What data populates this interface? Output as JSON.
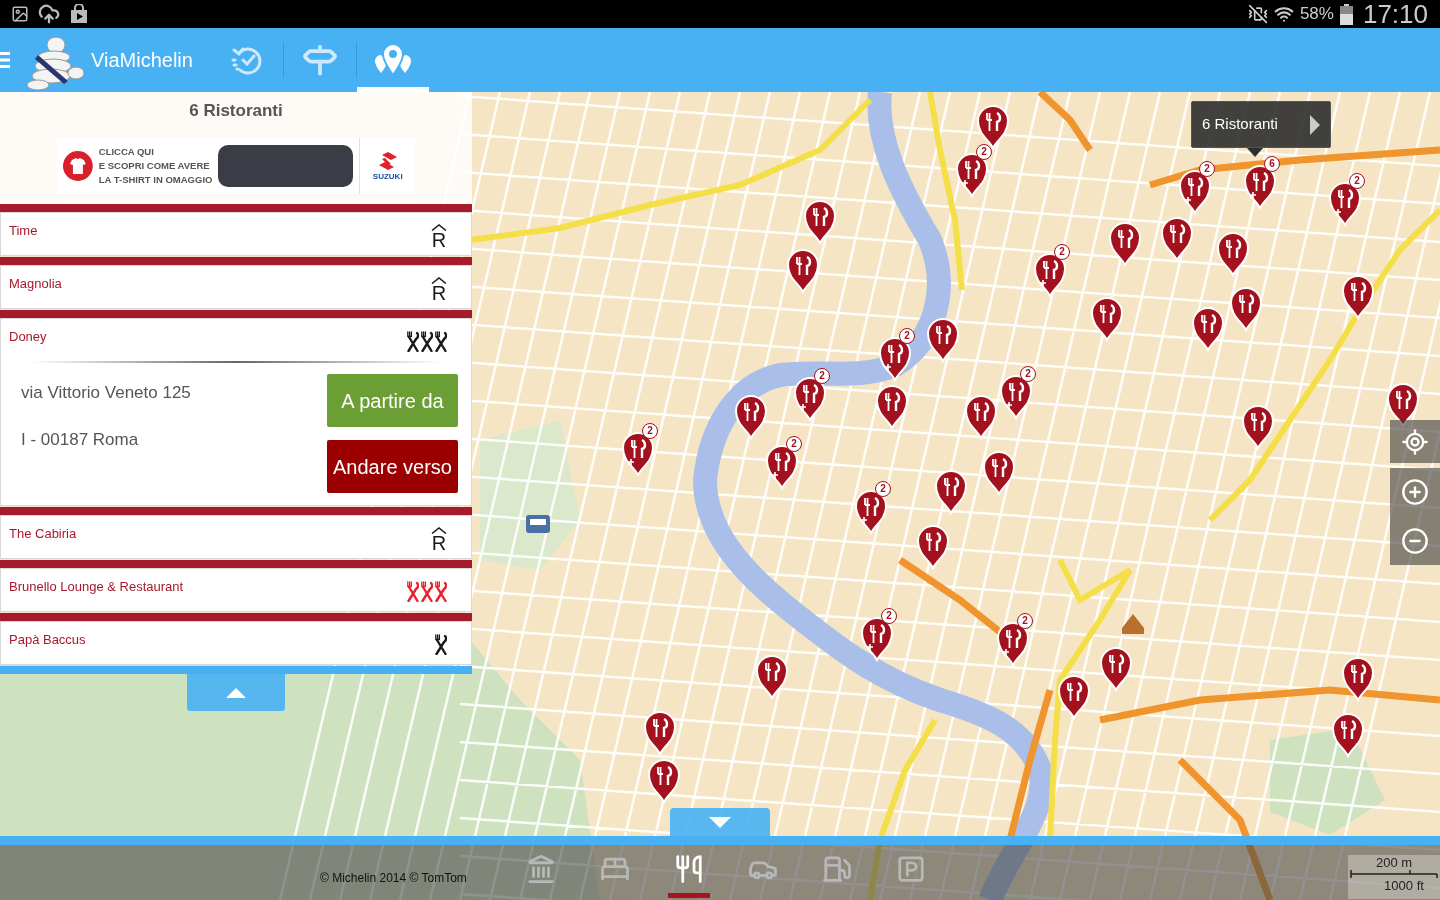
{
  "status_bar": {
    "battery": "58%",
    "time": "17:10"
  },
  "app_bar": {
    "title": "ViaMichelin",
    "tabs": [
      {
        "kind": "history",
        "selected": false
      },
      {
        "kind": "route",
        "selected": false
      },
      {
        "kind": "places",
        "selected": true
      }
    ]
  },
  "results_panel": {
    "heading": "6 Ristoranti",
    "ad": {
      "lines": [
        "CLICCA QUI",
        "E SCOPRI COME AVERE",
        "LA T-SHIRT IN OMAGGIO"
      ],
      "brand": "SUZUKI"
    },
    "restaurants": [
      {
        "name": "Time",
        "kind": "symbol",
        "symbol": "R",
        "expanded": false
      },
      {
        "name": "Magnolia",
        "kind": "symbol",
        "symbol": "R",
        "expanded": false
      },
      {
        "name": "Doney",
        "kind": "cutlery",
        "cutlery": [
          {
            "color": "#1a1a1a"
          },
          {
            "color": "#1a1a1a"
          },
          {
            "color": "#1a1a1a"
          }
        ],
        "expanded": true,
        "address": "via Vittorio Veneto 125",
        "city": "I - 00187 Roma",
        "buttons": [
          {
            "label": "A partire da",
            "kind": "from"
          },
          {
            "label": "Andare verso",
            "kind": "to"
          }
        ]
      },
      {
        "name": "The Cabiria",
        "kind": "symbol",
        "symbol": "R",
        "expanded": false
      },
      {
        "name": "Brunello Lounge & Restaurant",
        "kind": "cutlery",
        "cutlery": [
          {
            "color": "#e8202a"
          },
          {
            "color": "#e8202a"
          },
          {
            "color": "#e8202a"
          }
        ],
        "expanded": false
      },
      {
        "name": "Papà Baccus",
        "kind": "cutlery",
        "cutlery": [
          {
            "color": "#1a1a1a"
          }
        ],
        "expanded": false
      }
    ]
  },
  "map": {
    "callout": "6 Ristoranti",
    "pins": [
      {
        "kind": "single"
      },
      {
        "kind": "cluster",
        "badge": "2"
      },
      {
        "kind": "single"
      },
      {
        "kind": "single"
      },
      {
        "kind": "cluster",
        "badge": "2"
      },
      {
        "kind": "single"
      },
      {
        "kind": "single"
      },
      {
        "kind": "cluster",
        "badge": "2"
      },
      {
        "kind": "cluster",
        "badge": "6"
      },
      {
        "kind": "single"
      },
      {
        "kind": "cluster",
        "badge": "2"
      },
      {
        "kind": "single"
      },
      {
        "kind": "single"
      },
      {
        "kind": "single"
      },
      {
        "kind": "single"
      },
      {
        "kind": "single"
      },
      {
        "kind": "cluster",
        "badge": "2"
      },
      {
        "kind": "cluster",
        "badge": "2"
      },
      {
        "kind": "single"
      },
      {
        "kind": "single"
      },
      {
        "kind": "single"
      },
      {
        "kind": "cluster",
        "badge": "2"
      },
      {
        "kind": "cluster",
        "badge": "2"
      },
      {
        "kind": "cluster",
        "badge": "2"
      },
      {
        "kind": "single"
      },
      {
        "kind": "single"
      },
      {
        "kind": "single"
      },
      {
        "kind": "single"
      },
      {
        "kind": "cluster",
        "badge": "2"
      },
      {
        "kind": "single"
      },
      {
        "kind": "cluster",
        "badge": "2"
      },
      {
        "kind": "cluster",
        "badge": "2"
      },
      {
        "kind": "single"
      },
      {
        "kind": "single"
      },
      {
        "kind": "single"
      },
      {
        "kind": "single"
      },
      {
        "kind": "single"
      },
      {
        "kind": "single"
      },
      {
        "kind": "single"
      }
    ],
    "scale": {
      "metric": "200 m",
      "imperial": "1000 ft"
    },
    "attribution": "© Michelin 2014 © TomTom"
  },
  "category_bar": [
    {
      "kind": "museum",
      "selected": false
    },
    {
      "kind": "hotel",
      "selected": false
    },
    {
      "kind": "restaurant",
      "selected": true
    },
    {
      "kind": "garage",
      "selected": false
    },
    {
      "kind": "fuel",
      "selected": false
    },
    {
      "kind": "parking",
      "selected": false
    }
  ]
}
